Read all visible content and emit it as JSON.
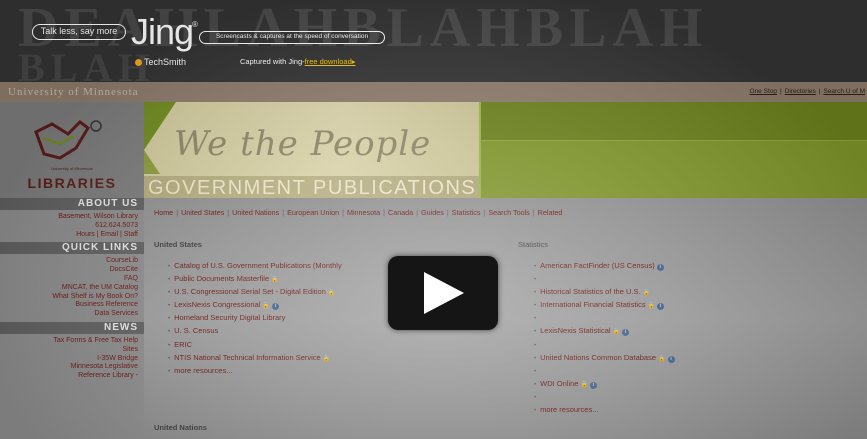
{
  "jing": {
    "bg_text_1": "DEAHLAHBLAHBLAH",
    "bg_text_2": "BLAH",
    "bubble": "Talk less, say more",
    "logo": "Jing",
    "reg": "®",
    "tagline": "Screencasts & captures at the speed of conversation",
    "techsmith": "TechSmith",
    "captured_prefix": "Captured with Jing-",
    "download_link": "free download",
    "download_arrow": "▸"
  },
  "umn": {
    "title": "University of Minnesota",
    "links": [
      "One Stop",
      "Directories",
      "Search U of M"
    ]
  },
  "branding": {
    "lib_small": "University of Minnesota",
    "lib_big": "LIBRARIES",
    "banner_script": "We the People",
    "banner_title": "GOVERNMENT PUBLICATIONS"
  },
  "sidebar": {
    "about": {
      "heading": "ABOUT US",
      "items": [
        "Basement, Wilson Library",
        "612.624.5073",
        "Hours | Email | Staff"
      ]
    },
    "quick_links": {
      "heading": "QUICK LINKS",
      "items": [
        "CourseLib",
        "DocsCite",
        "FAQ",
        "MNCAT, the UM Catalog",
        "What Shelf is My Book On?",
        "Business Reference",
        "Data Services"
      ]
    },
    "news": {
      "heading": "NEWS",
      "items": [
        "Tax Forms & Free Tax Help",
        "Sites",
        "I-35W Bridge",
        "Minnesota Legislative",
        "Reference Library -"
      ]
    }
  },
  "nav": [
    "Home",
    "United States",
    "United Nations",
    "European Union",
    "Minnesota",
    "Canada",
    "Guides",
    "Statistics",
    "Search Tools",
    "Related"
  ],
  "us": {
    "heading": "United States",
    "items": [
      {
        "label": "Catalog of U.S. Government Publications (Monthly",
        "lock": false,
        "info": false
      },
      {
        "label": "Public Documents Masterfile",
        "lock": true,
        "info": false
      },
      {
        "label": "U.S. Congressional Serial Set - Digital Edition",
        "lock": true,
        "info": false
      },
      {
        "label": "LexisNexis Congressional",
        "lock": true,
        "info": true
      },
      {
        "label": "Homeland Security Digital Library",
        "lock": false,
        "info": false
      },
      {
        "label": "U. S. Census",
        "lock": false,
        "info": false
      },
      {
        "label": "ERIC",
        "lock": false,
        "info": false
      },
      {
        "label": "NTIS National Technical Information Service",
        "lock": true,
        "info": false
      },
      {
        "label": "more resources...",
        "lock": false,
        "info": false
      }
    ]
  },
  "stats": {
    "heading": "Statistics",
    "items": [
      {
        "label": "American FactFinder (US Census)",
        "lock": false,
        "info": true
      },
      {
        "label": "",
        "lock": false,
        "info": false
      },
      {
        "label": "Historical Statistics of the U.S.",
        "lock": true,
        "info": false
      },
      {
        "label": "International Financial Statistics",
        "lock": true,
        "info": true
      },
      {
        "label": "",
        "lock": false,
        "info": false
      },
      {
        "label": "LexisNexis Statistical",
        "lock": true,
        "info": true
      },
      {
        "label": "",
        "lock": false,
        "info": false
      },
      {
        "label": "United Nations Common Database",
        "lock": true,
        "info": true
      },
      {
        "label": "",
        "lock": false,
        "info": false
      },
      {
        "label": "WDI Online",
        "lock": true,
        "info": true
      },
      {
        "label": "",
        "lock": false,
        "info": false
      },
      {
        "label": "more resources...",
        "lock": false,
        "info": false
      }
    ]
  },
  "un": {
    "heading": "United Nations"
  },
  "icons": {
    "play": "play-icon",
    "lock": "lock-icon",
    "info": "info-icon"
  }
}
